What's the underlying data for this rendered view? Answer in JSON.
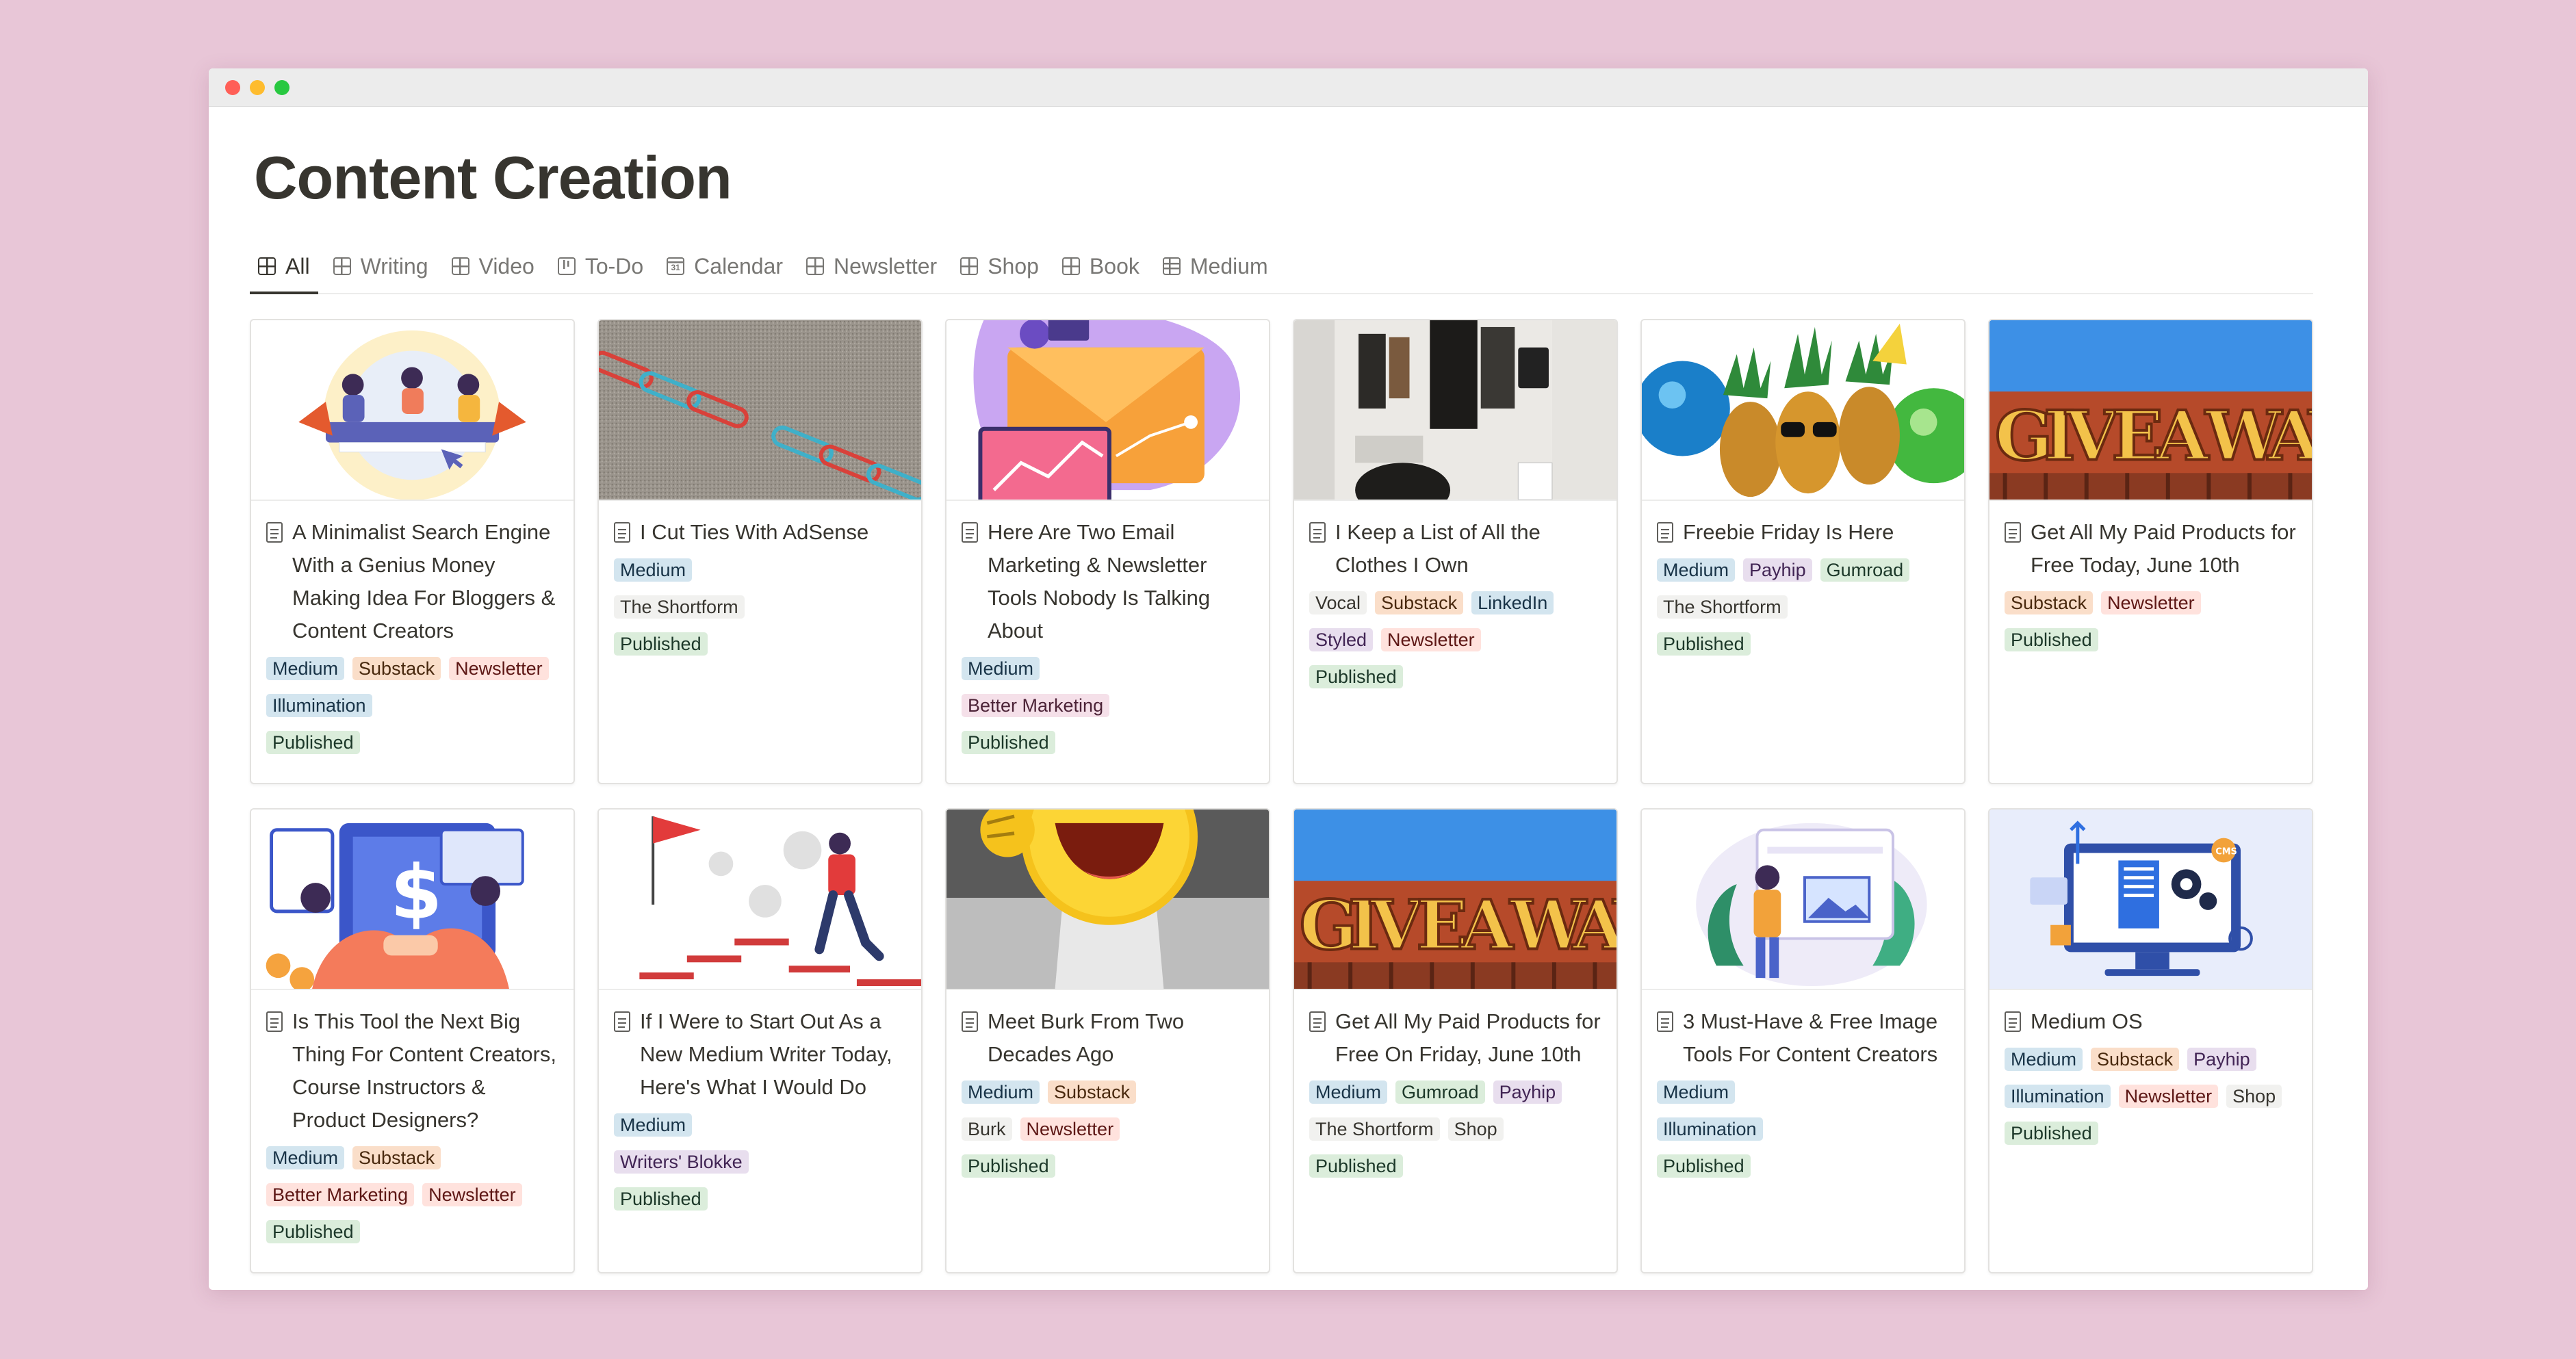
{
  "page": {
    "title": "Content Creation"
  },
  "tabs": [
    {
      "label": "All",
      "icon": "gallery-icon",
      "active": true
    },
    {
      "label": "Writing",
      "icon": "gallery-icon"
    },
    {
      "label": "Video",
      "icon": "gallery-icon"
    },
    {
      "label": "To-Do",
      "icon": "board-icon"
    },
    {
      "label": "Calendar",
      "icon": "calendar-icon"
    },
    {
      "label": "Newsletter",
      "icon": "gallery-icon"
    },
    {
      "label": "Shop",
      "icon": "gallery-icon"
    },
    {
      "label": "Book",
      "icon": "gallery-icon"
    },
    {
      "label": "Medium",
      "icon": "table-icon"
    }
  ],
  "colors": {
    "background": "#e8c6d7",
    "blue": "#d3e5ef",
    "orange": "#fadec9",
    "red": "#ffe2dd",
    "purple": "#e8deee",
    "green": "#dbeddb",
    "gray": "#f1f1ef"
  },
  "cards": [
    {
      "title": "A Minimalist Search Engine With a Genius Money Making Idea For Bloggers & Content Creators",
      "cover": "people-laptops",
      "platforms": [
        {
          "label": "Medium",
          "color": "blue"
        },
        {
          "label": "Substack",
          "color": "orange"
        },
        {
          "label": "Newsletter",
          "color": "red"
        },
        {
          "label": "Illumination",
          "color": "blue"
        }
      ],
      "publications": [],
      "status": {
        "label": "Published",
        "color": "green"
      }
    },
    {
      "title": "I Cut Ties With AdSense",
      "cover": "paperclip-chain",
      "platforms": [
        {
          "label": "Medium",
          "color": "blue"
        }
      ],
      "publications": [
        {
          "label": "The Shortform",
          "color": "gray"
        }
      ],
      "status": {
        "label": "Published",
        "color": "green"
      }
    },
    {
      "title": "Here Are Two Email Marketing & Newsletter Tools Nobody Is Talking About",
      "cover": "email-envelope",
      "platforms": [
        {
          "label": "Medium",
          "color": "blue"
        }
      ],
      "publications": [
        {
          "label": "Better Marketing",
          "color": "pink"
        }
      ],
      "status": {
        "label": "Published",
        "color": "green"
      }
    },
    {
      "title": "I Keep a List of All the Clothes I Own",
      "cover": "closet",
      "platforms": [
        {
          "label": "Vocal",
          "color": "gray"
        },
        {
          "label": "Substack",
          "color": "orange"
        },
        {
          "label": "LinkedIn",
          "color": "blue"
        },
        {
          "label": "Styled",
          "color": "purple"
        },
        {
          "label": "Newsletter",
          "color": "red"
        }
      ],
      "publications": [],
      "status": {
        "label": "Published",
        "color": "green"
      }
    },
    {
      "title": "Freebie Friday Is Here",
      "cover": "pineapples",
      "platforms": [
        {
          "label": "Medium",
          "color": "blue"
        },
        {
          "label": "Payhip",
          "color": "purple"
        },
        {
          "label": "Gumroad",
          "color": "green"
        }
      ],
      "publications": [
        {
          "label": "The Shortform",
          "color": "gray"
        }
      ],
      "status": {
        "label": "Published",
        "color": "green"
      }
    },
    {
      "title": "Get All My Paid Products for Free Today, June 10th",
      "cover": "giveaway-sign",
      "platforms": [
        {
          "label": "Substack",
          "color": "orange"
        },
        {
          "label": "Newsletter",
          "color": "red"
        }
      ],
      "publications": [],
      "status": {
        "label": "Published",
        "color": "green"
      }
    },
    {
      "title": "Is This Tool the Next Big Thing For Content Creators, Course Instructors & Product Designers?",
      "cover": "handshake-money",
      "platforms": [
        {
          "label": "Medium",
          "color": "blue"
        },
        {
          "label": "Substack",
          "color": "orange"
        }
      ],
      "publications": [
        {
          "label": "Better Marketing",
          "color": "red"
        },
        {
          "label": "Newsletter",
          "color": "red"
        }
      ],
      "status": {
        "label": "Published",
        "color": "green"
      }
    },
    {
      "title": "If I Were to Start Out As a New Medium Writer Today, Here's What I Would Do",
      "cover": "stairs-goal",
      "platforms": [
        {
          "label": "Medium",
          "color": "blue"
        }
      ],
      "publications": [
        {
          "label": "Writers' Blokke",
          "color": "purple"
        }
      ],
      "status": {
        "label": "Published",
        "color": "green"
      }
    },
    {
      "title": "Meet Burk From Two Decades Ago",
      "cover": "emoji-person",
      "platforms": [
        {
          "label": "Medium",
          "color": "blue"
        },
        {
          "label": "Substack",
          "color": "orange"
        }
      ],
      "publications": [
        {
          "label": "Burk",
          "color": "gray"
        },
        {
          "label": "Newsletter",
          "color": "red"
        }
      ],
      "status": {
        "label": "Published",
        "color": "green"
      }
    },
    {
      "title": "Get All My Paid Products for Free On Friday, June 10th",
      "cover": "giveaway-sign",
      "platforms": [
        {
          "label": "Medium",
          "color": "blue"
        },
        {
          "label": "Gumroad",
          "color": "green"
        },
        {
          "label": "Payhip",
          "color": "purple"
        }
      ],
      "publications": [
        {
          "label": "The Shortform",
          "color": "gray"
        },
        {
          "label": "Shop",
          "color": "gray"
        }
      ],
      "status": {
        "label": "Published",
        "color": "green"
      }
    },
    {
      "title": "3 Must-Have & Free Image Tools For Content Creators",
      "cover": "image-tools",
      "platforms": [
        {
          "label": "Medium",
          "color": "blue"
        }
      ],
      "publications": [
        {
          "label": "Illumination",
          "color": "blue"
        }
      ],
      "status": {
        "label": "Published",
        "color": "green"
      }
    },
    {
      "title": "Medium OS",
      "cover": "computer-cms",
      "platforms": [
        {
          "label": "Medium",
          "color": "blue"
        },
        {
          "label": "Substack",
          "color": "orange"
        },
        {
          "label": "Payhip",
          "color": "purple"
        },
        {
          "label": "Illumination",
          "color": "blue"
        },
        {
          "label": "Newsletter",
          "color": "red"
        },
        {
          "label": "Shop",
          "color": "gray"
        }
      ],
      "publications": [],
      "status": {
        "label": "Published",
        "color": "green"
      }
    }
  ]
}
